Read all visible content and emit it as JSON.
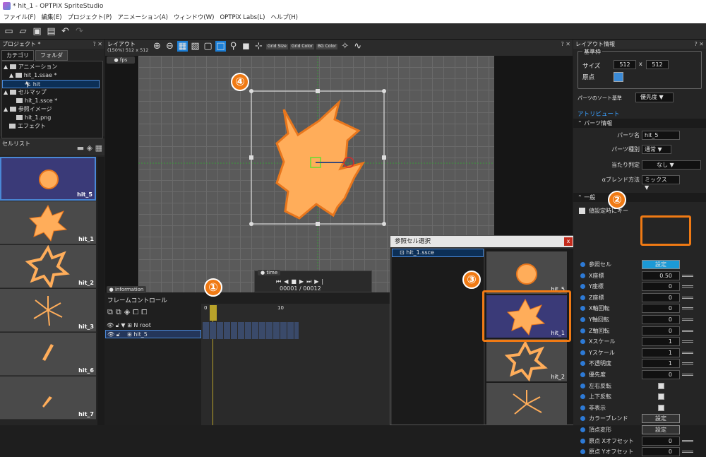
{
  "window": {
    "title": "* hit_1 - OPTPiX SpriteStudio"
  },
  "menu": [
    "ファイル(F)",
    "編集(E)",
    "プロジェクト(P)",
    "アニメーション(A)",
    "ウィンドウ(W)",
    "OPTPiX Labs(L)",
    "ヘルプ(H)"
  ],
  "project": {
    "title": "プロジェクト *",
    "tabs": [
      "カテゴリ",
      "フォルダ"
    ],
    "tree": [
      "アニメーション",
      "hit_1.ssae *",
      "hit",
      "セルマップ",
      "hit_1.ssce *",
      "参照イメージ",
      "hit_1.png",
      "エフェクト"
    ]
  },
  "celllist": {
    "title": "セルリスト",
    "cells": [
      "hit_5",
      "hit_1",
      "hit_2",
      "hit_3",
      "hit_6",
      "hit_7"
    ]
  },
  "layout": {
    "title": "レイアウト",
    "zoom": "(150%) 512 x 512",
    "fps_label": "fps",
    "toolbar_text": [
      "Grid Size",
      "Grid Color",
      "BG Color"
    ]
  },
  "time": {
    "label": "time",
    "current": "00001",
    "separator": "/",
    "total": "00012"
  },
  "information": {
    "label": "information"
  },
  "frame_control": {
    "title": "フレームコントロール",
    "ruler": [
      "0",
      "10"
    ],
    "rows": [
      "root",
      "hit_5"
    ]
  },
  "dialog": {
    "title": "参照セル選択",
    "list_item": "hit_1.ssce",
    "thumbs": [
      "hit_5",
      "hit_1",
      "hit_2"
    ]
  },
  "right": {
    "layout_info": "レイアウト情報",
    "base_frame": "基準枠",
    "size_label": "サイズ",
    "size_w": "512",
    "size_x": "x",
    "size_h": "512",
    "origin_label": "原点",
    "sort_label": "パーツのソート基準",
    "sort_value": "優先度",
    "attribute": "アトリビュート",
    "parts_info": "パーツ情報",
    "part_name_label": "パーツ名",
    "part_name": "hit_5",
    "part_type_label": "パーツ種別",
    "part_type": "通常",
    "hit_label": "当たり判定",
    "hit_value": "なし",
    "blend_label": "αブレンド方法",
    "blend_value": "ミックス",
    "general": "一般",
    "when_set": "値設定時にキー",
    "props": [
      {
        "name": "参照セル",
        "kind": "btn",
        "value": "設定"
      },
      {
        "name": "X座標",
        "kind": "val",
        "value": "0.50"
      },
      {
        "name": "Y座標",
        "kind": "val",
        "value": "0"
      },
      {
        "name": "Z座標",
        "kind": "val",
        "value": "0"
      },
      {
        "name": "X軸回転",
        "kind": "val",
        "value": "0"
      },
      {
        "name": "Y軸回転",
        "kind": "val",
        "value": "0"
      },
      {
        "name": "Z軸回転",
        "kind": "val",
        "value": "0"
      },
      {
        "name": "Xスケール",
        "kind": "val",
        "value": "1"
      },
      {
        "name": "Yスケール",
        "kind": "val",
        "value": "1"
      },
      {
        "name": "不透明度",
        "kind": "val",
        "value": "1"
      },
      {
        "name": "優先度",
        "kind": "val",
        "value": "0"
      },
      {
        "name": "左右反転",
        "kind": "chk",
        "value": ""
      },
      {
        "name": "上下反転",
        "kind": "chk",
        "value": ""
      },
      {
        "name": "非表示",
        "kind": "chk",
        "value": ""
      },
      {
        "name": "カラーブレンド",
        "kind": "btn",
        "value": "設定"
      },
      {
        "name": "頂点変形",
        "kind": "btn",
        "value": "設定"
      },
      {
        "name": "原点 Xオフセット",
        "kind": "val",
        "value": "0"
      },
      {
        "name": "原点 Yオフセット",
        "kind": "val",
        "value": "0"
      }
    ]
  },
  "callouts": [
    "①",
    "②",
    "③",
    "④"
  ],
  "colors": {
    "accent": "#f07a14",
    "selection": "#4a88d6",
    "sprite": "#ffad5a"
  }
}
